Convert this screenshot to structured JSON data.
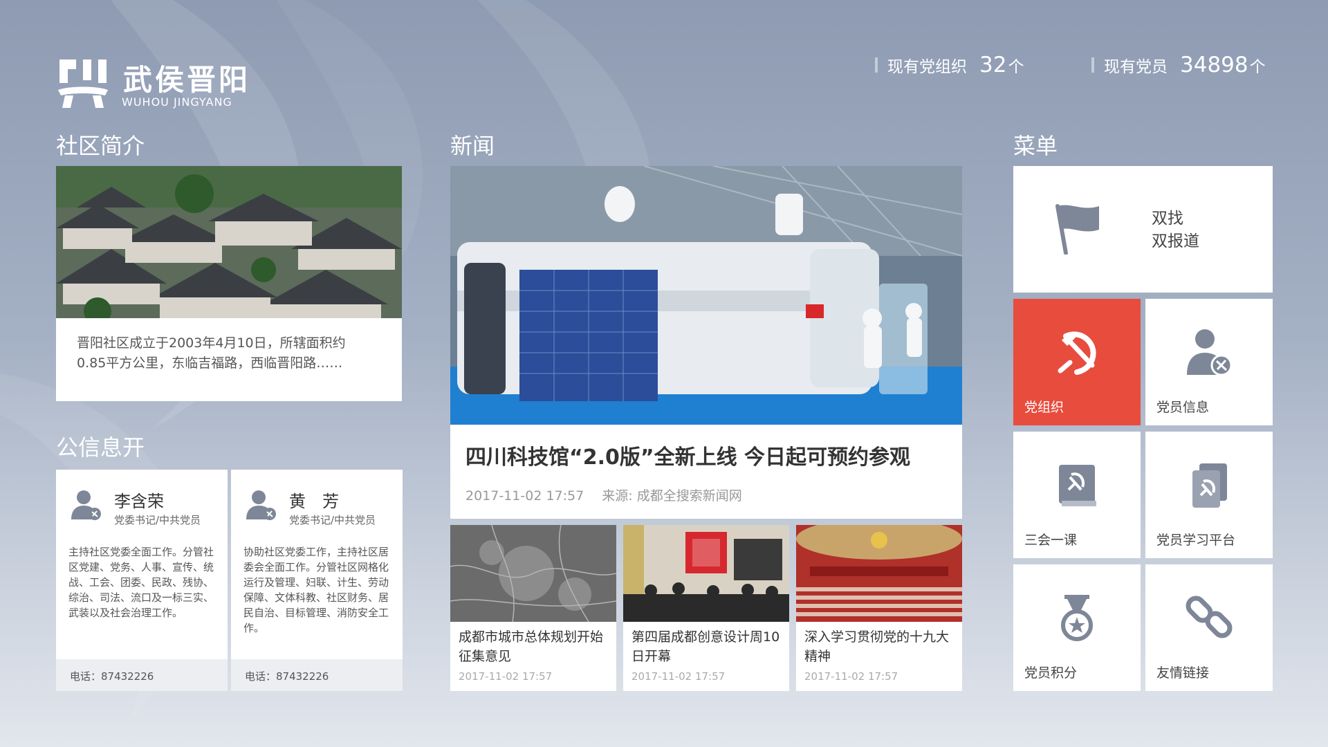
{
  "header": {
    "logo_title": "武侯晋阳",
    "logo_subtitle": "WUHOU JINGYANG",
    "stats": [
      {
        "label": "现有党组织",
        "value": "32",
        "unit": "个"
      },
      {
        "label": "现有党员",
        "value": "34898",
        "unit": "个"
      }
    ]
  },
  "sections": {
    "community": "社区简介",
    "news": "新闻",
    "menu": "菜单",
    "public": "公信息开"
  },
  "community": {
    "text_line1": "晋阳社区成立于2003年4月10日，所辖面积约",
    "text_line2": "0.85平方公里，东临吉福路，西临晋阳路……"
  },
  "people": [
    {
      "name": "李含荣",
      "role": "党委书记/中共党员",
      "desc": "主持社区党委全面工作。分管社区党建、党务、人事、宣传、统战、工会、团委、民政、残协、综治、司法、流口及一标三实、武装以及社会治理工作。",
      "phone": "电话：87432226"
    },
    {
      "name": "黄　芳",
      "role": "党委书记/中共党员",
      "desc": "协助社区党委工作，主持社区居委会全面工作。分管社区网格化运行及管理、妇联、计生、劳动保障、文体科教、社区财务、居民自治、目标管理、消防安全工作。",
      "phone": "电话：87432226"
    }
  ],
  "news": {
    "main": {
      "title": "四川科技馆“2.0版”全新上线 今日起可预约参观",
      "date": "2017-11-02 17:57",
      "source": "来源: 成都全搜索新闻网"
    },
    "items": [
      {
        "title": "成都市城市总体规划开始征集意见",
        "date": "2017-11-02 17:57"
      },
      {
        "title": "第四届成都创意设计周10日开幕",
        "date": "2017-11-02 17:57"
      },
      {
        "title": "深入学习贯彻党的十九大精神",
        "date": "2017-11-02 17:57"
      }
    ]
  },
  "menu": {
    "top_line1": "双找",
    "top_line2": "双报道",
    "tiles": [
      {
        "label": "党组织",
        "icon": "hammer-sickle-icon"
      },
      {
        "label": "党员信息",
        "icon": "member-icon"
      },
      {
        "label": "三会一课",
        "icon": "book-icon"
      },
      {
        "label": "党员学习平台",
        "icon": "study-icon"
      },
      {
        "label": "党员积分",
        "icon": "medal-icon"
      },
      {
        "label": "友情链接",
        "icon": "link-icon"
      }
    ]
  },
  "colors": {
    "accent_red": "#e84c3d",
    "icon_gray": "#7e8798"
  }
}
